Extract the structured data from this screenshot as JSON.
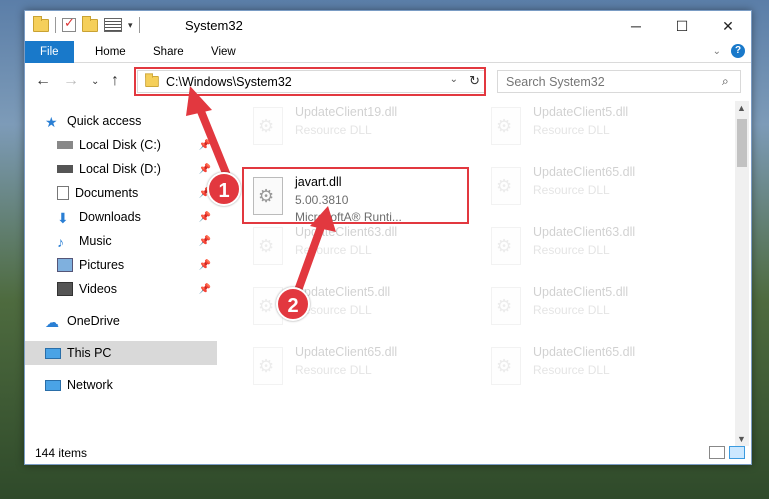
{
  "window": {
    "title": "System32",
    "caption": {
      "minimize": "─",
      "maximize": "☐",
      "close": "✕"
    }
  },
  "ribbon": {
    "tabs": [
      "File",
      "Home",
      "Share",
      "View"
    ]
  },
  "address": {
    "path": "C:\\Windows\\System32"
  },
  "search": {
    "placeholder": "Search System32"
  },
  "sidebar": {
    "items": [
      {
        "label": "Quick access",
        "icon": "star-icon"
      },
      {
        "label": "Local Disk (C:)",
        "icon": "drive-icon"
      },
      {
        "label": "Local Disk (D:)",
        "icon": "drive-icon"
      },
      {
        "label": "Documents",
        "icon": "documents-icon"
      },
      {
        "label": "Downloads",
        "icon": "download-icon"
      },
      {
        "label": "Music",
        "icon": "music-icon"
      },
      {
        "label": "Pictures",
        "icon": "pictures-icon"
      },
      {
        "label": "Videos",
        "icon": "videos-icon"
      },
      {
        "label": "OneDrive",
        "icon": "cloud-icon"
      },
      {
        "label": "This PC",
        "icon": "computer-icon"
      },
      {
        "label": "Network",
        "icon": "network-icon"
      }
    ]
  },
  "files": [
    {
      "name": "UpdateClient19.dll",
      "type": "Resource DLL",
      "faded": true
    },
    {
      "name": "UpdateClient5.dll",
      "type": "Resource DLL",
      "faded": true
    },
    {
      "name": "javart.dll",
      "version": "5.00.3810",
      "company": "MicrosoftA® Runti...",
      "faded": false
    },
    {
      "name": "UpdateClient65.dll",
      "type": "Resource DLL",
      "faded": true
    },
    {
      "name": "UpdateClient63.dll",
      "type": "Resource DLL",
      "faded": true
    },
    {
      "name": "UpdateClient63.dll",
      "type": "Resource DLL",
      "faded": true
    },
    {
      "name": "UpdateClient5.dll",
      "type": "Resource DLL",
      "faded": true
    },
    {
      "name": "UpdateClient5.dll",
      "type": "Resource DLL",
      "faded": true
    },
    {
      "name": "UpdateClient65.dll",
      "type": "Resource DLL",
      "faded": true
    },
    {
      "name": "UpdateClient65.dll",
      "type": "Resource DLL",
      "faded": true
    }
  ],
  "status": {
    "item_count": "144 items"
  },
  "markers": [
    "1",
    "2"
  ],
  "colors": {
    "accent": "#1979ca",
    "highlight": "#e2383f"
  }
}
